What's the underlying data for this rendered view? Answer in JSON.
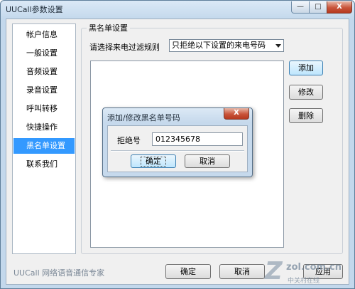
{
  "window": {
    "title": "UUCall参数设置",
    "caption_buttons": {
      "minimize": "—",
      "maximize": "□",
      "close": "X"
    }
  },
  "sidebar": {
    "items": [
      {
        "label": "帐户信息",
        "selected": false
      },
      {
        "label": "一般设置",
        "selected": false
      },
      {
        "label": "音频设置",
        "selected": false
      },
      {
        "label": "录音设置",
        "selected": false
      },
      {
        "label": "呼叫转移",
        "selected": false
      },
      {
        "label": "快捷操作",
        "selected": false
      },
      {
        "label": "黑名单设置",
        "selected": true
      },
      {
        "label": "联系我们",
        "selected": false
      }
    ]
  },
  "blacklist": {
    "group_title": "黑名单设置",
    "rule_label": "请选择来电过滤规则",
    "rule_selected": "只拒绝以下设置的来电号码",
    "buttons": {
      "add": "添加",
      "modify": "修改",
      "delete": "删除"
    }
  },
  "dialog": {
    "title": "添加/修改黑名单号码",
    "close_label": "X",
    "field_label": "拒绝号",
    "field_value": "012345678",
    "ok": "确定",
    "cancel": "取消"
  },
  "footer": {
    "brand_text": "UUCall 网络语音通信专家",
    "ok": "确定",
    "cancel": "取消",
    "apply": "应用"
  },
  "watermark": {
    "mark": "Z",
    "site": "zol.com.cn",
    "sub": "中关村在线"
  },
  "colors": {
    "selection": "#3399ff",
    "title_bar": "#c3d8ec",
    "close_button": "#c9543a"
  }
}
